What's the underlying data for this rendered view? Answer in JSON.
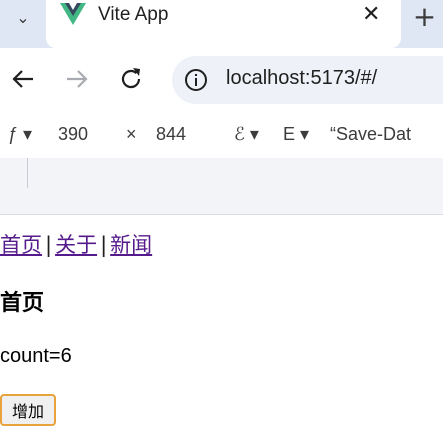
{
  "browser": {
    "tab": {
      "title": "Vite App",
      "close_label": "✕"
    },
    "tab_dropdown_label": "⌄",
    "new_tab_label": "+",
    "url": "localhost:5173/#/"
  },
  "devtools_bar": {
    "device_menu": "ƒ ▾",
    "width": "390",
    "times": "×",
    "height": "844",
    "zoom_menu": "ℰ ▾",
    "throttle_menu": "Ε ▾",
    "save_data": "“Save-Dat"
  },
  "page": {
    "nav_links": [
      "首页",
      "关于",
      "新闻"
    ],
    "separator": "|",
    "heading": "首页",
    "count_text": "count=6",
    "button_label": "增加"
  },
  "colors": {
    "tabstrip_bg": "#dfe7f5",
    "vue_green": "#41b883",
    "vue_dark": "#34495e",
    "visited_link": "#551a8b",
    "focus_ring": "#e8a33d"
  }
}
